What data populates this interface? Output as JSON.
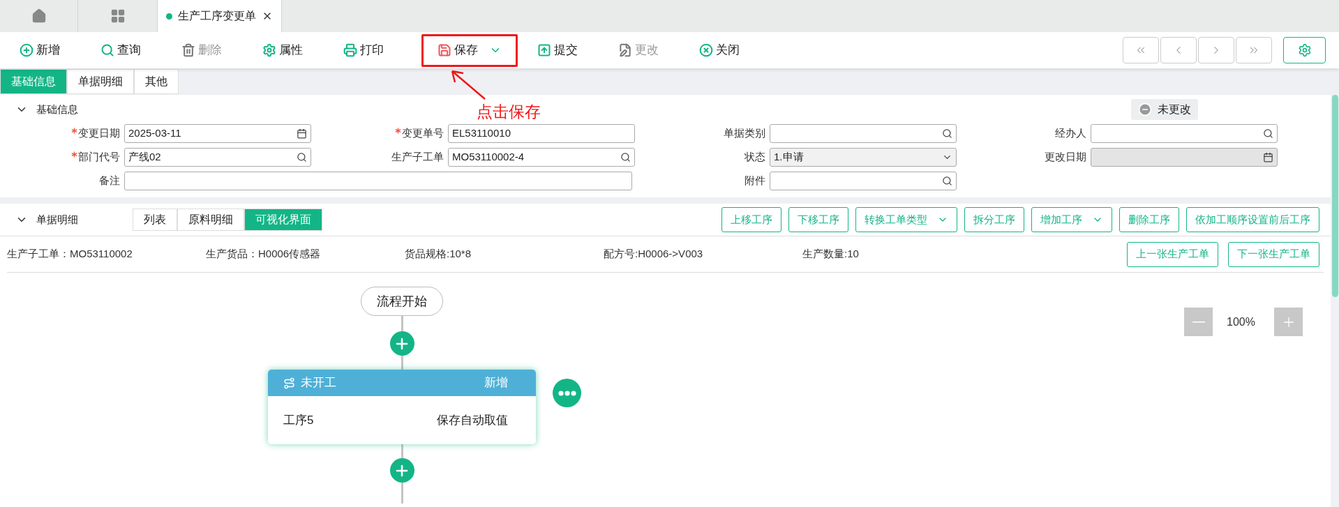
{
  "tabs": [
    {
      "kind": "home",
      "selected": false
    },
    {
      "kind": "apps",
      "selected": false
    },
    {
      "kind": "document",
      "label": "生产工序变更单",
      "selected": true
    }
  ],
  "toolbar": [
    {
      "label": "新增",
      "disabled": false,
      "highlighted": false,
      "dropdown": false
    },
    {
      "label": "查询",
      "disabled": false,
      "highlighted": false,
      "dropdown": false
    },
    {
      "label": "删除",
      "disabled": true,
      "highlighted": false,
      "dropdown": false
    },
    {
      "label": "属性",
      "disabled": false,
      "highlighted": false,
      "dropdown": false
    },
    {
      "label": "打印",
      "disabled": false,
      "highlighted": false,
      "dropdown": false
    },
    {
      "label": "保存",
      "disabled": false,
      "highlighted": true,
      "dropdown": true
    },
    {
      "label": "提交",
      "disabled": false,
      "highlighted": false,
      "dropdown": false
    },
    {
      "label": "更改",
      "disabled": true,
      "highlighted": false,
      "dropdown": false
    },
    {
      "label": "关闭",
      "disabled": false,
      "highlighted": false,
      "dropdown": false
    }
  ],
  "annotation": "点击保存",
  "page_tabs": [
    {
      "label": "基础信息",
      "selected": true
    },
    {
      "label": "单据明细",
      "selected": false
    },
    {
      "label": "其他",
      "selected": false
    }
  ],
  "basic_section": {
    "title": "基础信息",
    "expanded": true,
    "status": "未更改"
  },
  "fields": [
    {
      "label": "变更日期",
      "required": true,
      "value": "2025-03-11",
      "kind": "date",
      "disabled": false
    },
    {
      "label": "变更单号",
      "required": true,
      "value": "EL53110010",
      "kind": "text",
      "disabled": false
    },
    {
      "label": "单据类别",
      "required": false,
      "kind": "lookup",
      "disabled": false
    },
    {
      "label": "经办人",
      "required": false,
      "kind": "lookup",
      "disabled": false
    },
    {
      "label": "部门代号",
      "required": true,
      "value": "产线02",
      "kind": "lookup",
      "disabled": false
    },
    {
      "label": "生产子工单",
      "required": false,
      "value": "MO53110002-4",
      "kind": "lookup",
      "disabled": false
    },
    {
      "label": "状态",
      "required": false,
      "value": "1.申请",
      "kind": "select",
      "disabled": false
    },
    {
      "label": "更改日期",
      "required": false,
      "kind": "date",
      "disabled": true
    },
    {
      "label": "备注",
      "required": false,
      "kind": "wide",
      "disabled": false
    },
    {
      "label": "附件",
      "required": false,
      "kind": "lookup",
      "disabled": false
    }
  ],
  "detail_section": {
    "title": "单据明细",
    "expanded": true,
    "views": [
      {
        "label": "列表",
        "selected": false
      },
      {
        "label": "原料明细",
        "selected": false
      },
      {
        "label": "可视化界面",
        "selected": true
      }
    ],
    "actions": [
      {
        "label": "上移工序",
        "dropdown": false
      },
      {
        "label": "下移工序",
        "dropdown": false
      },
      {
        "label": "转换工单类型",
        "dropdown": true
      },
      {
        "label": "拆分工序",
        "dropdown": false
      },
      {
        "label": "增加工序",
        "dropdown": true
      },
      {
        "label": "删除工序",
        "dropdown": false
      },
      {
        "label": "依加工顺序设置前后工序",
        "dropdown": false
      }
    ]
  },
  "info": [
    "生产子工单：MO53110002",
    "生产货品：H0006传感器",
    "货品规格:10*8",
    "配方号:H0006->V003",
    "生产数量:10"
  ],
  "order_nav": [
    "上一张生产工单",
    "下一张生产工单"
  ],
  "flow": {
    "start": "流程开始",
    "zoom": "100%",
    "steps": [
      {
        "status": "未开工",
        "tag": "新增",
        "name": "工序5",
        "note": "保存自动取值"
      }
    ]
  }
}
